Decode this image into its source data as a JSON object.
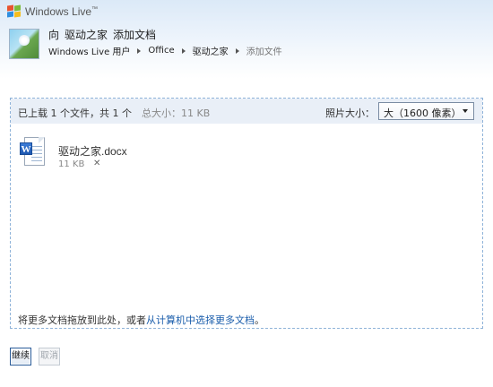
{
  "brand": {
    "name": "Windows Live",
    "trademark": "™"
  },
  "header": {
    "title_prefix": "向",
    "title_folder": "驱动之家",
    "title_action": "添加文档",
    "breadcrumb": [
      {
        "label": "Windows Live 用户"
      },
      {
        "label": "Office"
      },
      {
        "label": "驱动之家"
      },
      {
        "label": "添加文件"
      }
    ]
  },
  "upload": {
    "status": "已上载 1 个文件，共 1 个",
    "total_size": "总大小：11 KB",
    "photo_size_label": "照片大小：",
    "photo_size_selected": "大（1600 像素）",
    "files": [
      {
        "name": "驱动之家.docx",
        "size": "11 KB",
        "remove_glyph": "✕",
        "icon": "word-document-icon",
        "badge_letter": "W"
      }
    ],
    "drop_hint_prefix": "将更多文档拖放到此处，或者",
    "drop_hint_link": "从计算机中选择更多文档",
    "drop_hint_suffix": "。"
  },
  "buttons": {
    "continue_label": "继续",
    "cancel_label": "取消"
  },
  "colors": {
    "accent_link": "#1a5dab",
    "dashed_border": "#8fb3d9",
    "zone_bar": "#e9eff7"
  }
}
